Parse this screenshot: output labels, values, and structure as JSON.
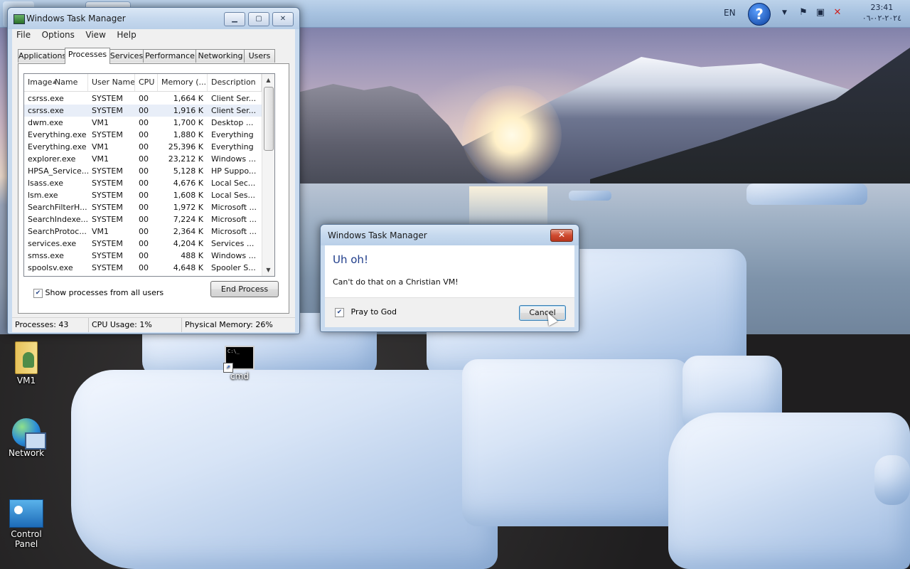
{
  "taskbar": {
    "tray": {
      "language": "EN",
      "help_icon_glyph": "?",
      "time": "23:41",
      "date": "٢٠٢٤-٠٢-٠٦"
    }
  },
  "desktop_icons": [
    {
      "label": "VM1",
      "icon": "user-folder-icon"
    },
    {
      "label": "cmd",
      "icon": "cmd-icon"
    },
    {
      "label": "Network",
      "icon": "network-icon"
    },
    {
      "label": "Control Panel",
      "icon": "control-panel-icon"
    }
  ],
  "task_manager": {
    "title": "Windows Task Manager",
    "menu": [
      "File",
      "Options",
      "View",
      "Help"
    ],
    "tabs": [
      "Applications",
      "Processes",
      "Services",
      "Performance",
      "Networking",
      "Users"
    ],
    "active_tab": "Processes",
    "columns": [
      "Image Name",
      "User Name",
      "CPU",
      "Memory (...",
      "Description"
    ],
    "processes": [
      {
        "name": "csrss.exe",
        "user": "SYSTEM",
        "cpu": "00",
        "mem": "1,664 K",
        "desc": "Client Ser..."
      },
      {
        "name": "csrss.exe",
        "user": "SYSTEM",
        "cpu": "00",
        "mem": "1,916 K",
        "desc": "Client Ser..."
      },
      {
        "name": "dwm.exe",
        "user": "VM1",
        "cpu": "00",
        "mem": "1,700 K",
        "desc": "Desktop ..."
      },
      {
        "name": "Everything.exe",
        "user": "SYSTEM",
        "cpu": "00",
        "mem": "1,880 K",
        "desc": "Everything"
      },
      {
        "name": "Everything.exe",
        "user": "VM1",
        "cpu": "00",
        "mem": "25,396 K",
        "desc": "Everything"
      },
      {
        "name": "explorer.exe",
        "user": "VM1",
        "cpu": "00",
        "mem": "23,212 K",
        "desc": "Windows ..."
      },
      {
        "name": "HPSA_Service...",
        "user": "SYSTEM",
        "cpu": "00",
        "mem": "5,128 K",
        "desc": "HP Suppo..."
      },
      {
        "name": "lsass.exe",
        "user": "SYSTEM",
        "cpu": "00",
        "mem": "4,676 K",
        "desc": "Local Sec..."
      },
      {
        "name": "lsm.exe",
        "user": "SYSTEM",
        "cpu": "00",
        "mem": "1,608 K",
        "desc": "Local Ses..."
      },
      {
        "name": "SearchFilterH...",
        "user": "SYSTEM",
        "cpu": "00",
        "mem": "1,972 K",
        "desc": "Microsoft ..."
      },
      {
        "name": "SearchIndexe...",
        "user": "SYSTEM",
        "cpu": "00",
        "mem": "7,224 K",
        "desc": "Microsoft ..."
      },
      {
        "name": "SearchProtoc...",
        "user": "VM1",
        "cpu": "00",
        "mem": "2,364 K",
        "desc": "Microsoft ..."
      },
      {
        "name": "services.exe",
        "user": "SYSTEM",
        "cpu": "00",
        "mem": "4,204 K",
        "desc": "Services ..."
      },
      {
        "name": "smss.exe",
        "user": "SYSTEM",
        "cpu": "00",
        "mem": "488 K",
        "desc": "Windows ..."
      },
      {
        "name": "spoolsv.exe",
        "user": "SYSTEM",
        "cpu": "00",
        "mem": "4,648 K",
        "desc": "Spooler S..."
      }
    ],
    "selected_row": 1,
    "show_all_users_label": "Show processes from all users",
    "show_all_users_checked": true,
    "end_process_label": "End Process",
    "status": {
      "processes": "Processes: 43",
      "cpu": "CPU Usage: 1%",
      "memory": "Physical Memory: 26%"
    }
  },
  "dialog": {
    "title": "Windows Task Manager",
    "heading": "Uh oh!",
    "message": "Can't do that on a Christian VM!",
    "checkbox_label": "Pray to God",
    "checkbox_checked": true,
    "cancel_label": "Cancel"
  }
}
